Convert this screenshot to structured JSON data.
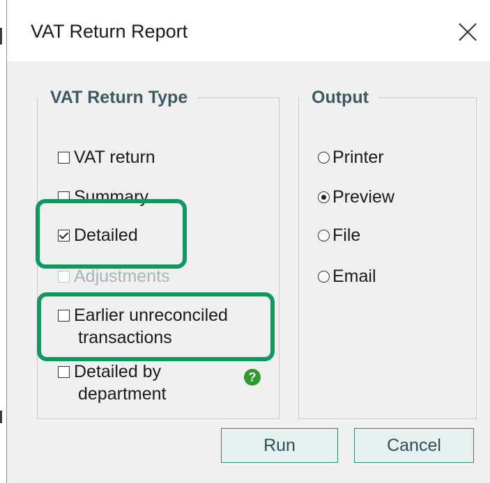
{
  "dialog": {
    "title": "VAT Return Report",
    "close_icon": "close-icon"
  },
  "vat_return_type": {
    "legend": "VAT Return Type",
    "options": [
      {
        "label": "VAT return",
        "checked": false,
        "enabled": true
      },
      {
        "label": "Summary",
        "checked": false,
        "enabled": true
      },
      {
        "label": "Detailed",
        "checked": true,
        "enabled": true
      },
      {
        "label": "Adjustments",
        "checked": false,
        "enabled": false
      },
      {
        "label_line1": "Earlier unreconciled",
        "label_line2": "transactions",
        "checked": false,
        "enabled": true
      },
      {
        "label_line1": "Detailed by",
        "label_line2": "department",
        "checked": false,
        "enabled": true
      }
    ],
    "help_icon": "question-mark-icon",
    "help_glyph": "?"
  },
  "output": {
    "legend": "Output",
    "options": [
      {
        "label": "Printer",
        "selected": false
      },
      {
        "label": "Preview",
        "selected": true
      },
      {
        "label": "File",
        "selected": false
      },
      {
        "label": "Email",
        "selected": false
      }
    ]
  },
  "buttons": {
    "run": "Run",
    "cancel": "Cancel"
  },
  "colors": {
    "highlight": "#0e9a5e",
    "legend_text": "#3c5a64",
    "help_icon": "#2e9a2e",
    "button_border": "#2a8a6e",
    "button_fill": "#e5f1f0"
  }
}
